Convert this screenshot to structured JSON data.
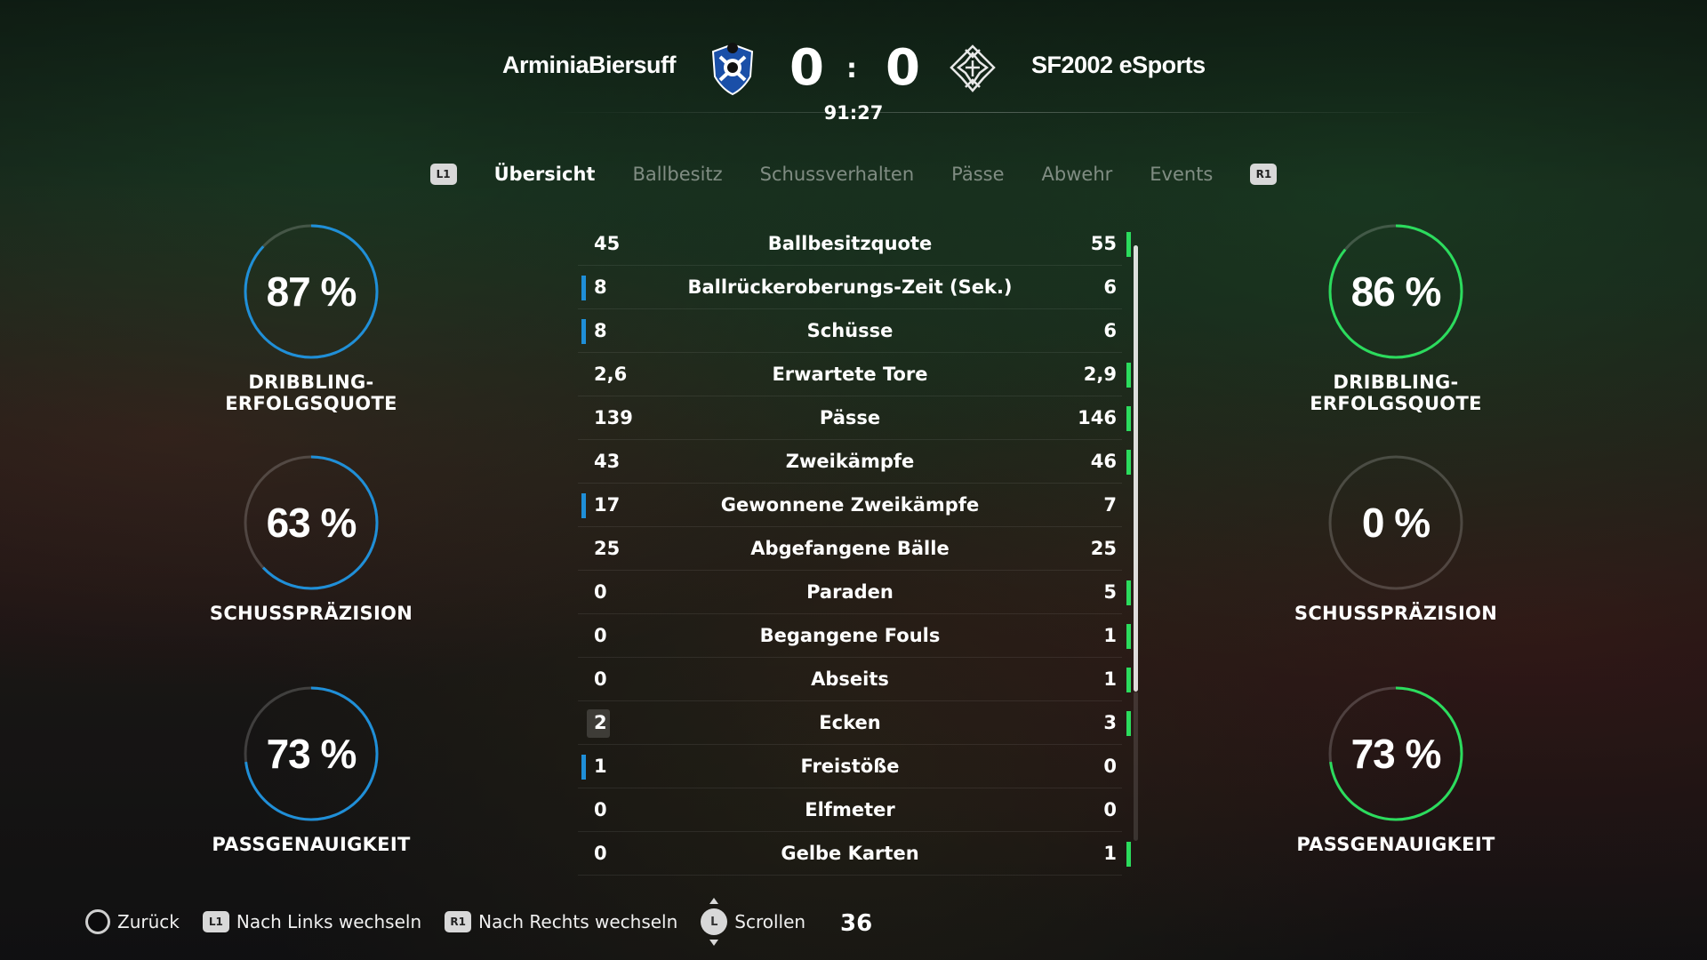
{
  "match": {
    "home_team": "ArminiaBiersuff",
    "away_team": "SF2002 eSports",
    "home_score": "0",
    "score_separator": ":",
    "away_score": "0",
    "clock": "91:27"
  },
  "tabs": {
    "left_shoulder": "L1",
    "right_shoulder": "R1",
    "items": [
      {
        "label": "Übersicht",
        "active": true
      },
      {
        "label": "Ballbesitz",
        "active": false
      },
      {
        "label": "Schussverhalten",
        "active": false
      },
      {
        "label": "Pässe",
        "active": false
      },
      {
        "label": "Abwehr",
        "active": false
      },
      {
        "label": "Events",
        "active": false
      }
    ]
  },
  "rings": {
    "home": [
      {
        "value": "87 %",
        "fraction": 0.87,
        "label": "DRIBBLING-ERFOLGSQUOTE"
      },
      {
        "value": "63 %",
        "fraction": 0.63,
        "label": "SCHUSSPRÄZISION"
      },
      {
        "value": "73 %",
        "fraction": 0.73,
        "label": "PASSGENAUIGKEIT"
      }
    ],
    "away": [
      {
        "value": "86 %",
        "fraction": 0.86,
        "label": "DRIBBLING-ERFOLGSQUOTE"
      },
      {
        "value": "0 %",
        "fraction": 0.0,
        "label": "SCHUSSPRÄZISION"
      },
      {
        "value": "73 %",
        "fraction": 0.73,
        "label": "PASSGENAUIGKEIT"
      }
    ],
    "home_color": "#1f8fd8",
    "away_color": "#2bdc5d"
  },
  "stats": [
    {
      "name": "Ballbesitzquote",
      "home": "45",
      "away": "55",
      "leader": "away"
    },
    {
      "name": "Ballrückeroberungs-Zeit (Sek.)",
      "home": "8",
      "away": "6",
      "leader": "home"
    },
    {
      "name": "Schüsse",
      "home": "8",
      "away": "6",
      "leader": "home"
    },
    {
      "name": "Erwartete Tore",
      "home": "2,6",
      "away": "2,9",
      "leader": "away"
    },
    {
      "name": "Pässe",
      "home": "139",
      "away": "146",
      "leader": "away"
    },
    {
      "name": "Zweikämpfe",
      "home": "43",
      "away": "46",
      "leader": "away"
    },
    {
      "name": "Gewonnene Zweikämpfe",
      "home": "17",
      "away": "7",
      "leader": "home"
    },
    {
      "name": "Abgefangene Bälle",
      "home": "25",
      "away": "25",
      "leader": "none"
    },
    {
      "name": "Paraden",
      "home": "0",
      "away": "5",
      "leader": "away"
    },
    {
      "name": "Begangene Fouls",
      "home": "0",
      "away": "1",
      "leader": "away"
    },
    {
      "name": "Abseits",
      "home": "0",
      "away": "1",
      "leader": "away"
    },
    {
      "name": "Ecken",
      "home": "2",
      "away": "3",
      "leader": "away",
      "highlight": true
    },
    {
      "name": "Freistöße",
      "home": "1",
      "away": "0",
      "leader": "home"
    },
    {
      "name": "Elfmeter",
      "home": "0",
      "away": "0",
      "leader": "none"
    },
    {
      "name": "Gelbe Karten",
      "home": "0",
      "away": "1",
      "leader": "away"
    }
  ],
  "footer": {
    "back": "Zurück",
    "left_btn": "L1",
    "left": "Nach Links wechseln",
    "right_btn": "R1",
    "right": "Nach Rechts wechseln",
    "stick": "L",
    "scroll": "Scrollen",
    "count": "36"
  }
}
